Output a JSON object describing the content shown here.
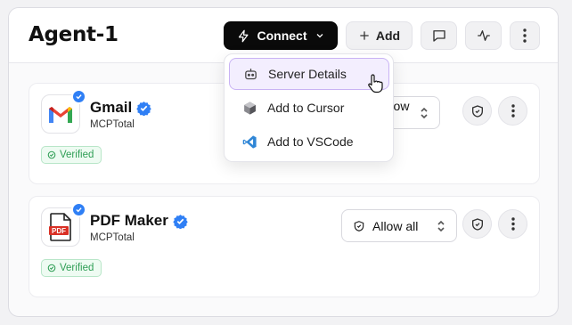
{
  "header": {
    "title": "Agent-1",
    "connect_label": "Connect",
    "add_label": "Add"
  },
  "dropdown": {
    "items": [
      {
        "label": "Server Details",
        "icon": "robot-icon"
      },
      {
        "label": "Add to Cursor",
        "icon": "cursor-cube-icon"
      },
      {
        "label": "Add to VSCode",
        "icon": "vscode-icon"
      }
    ]
  },
  "servers": [
    {
      "name": "Gmail",
      "provider": "MCPTotal",
      "badge": "Verified",
      "permission": "Allow all"
    },
    {
      "name": "PDF Maker",
      "provider": "MCPTotal",
      "badge": "Verified",
      "permission": "Allow all",
      "icon_text": "PDF"
    }
  ],
  "colors": {
    "accent_blue": "#2f7ff5",
    "verified_green": "#2f9e55",
    "menu_highlight_border": "#c9b3f4"
  }
}
